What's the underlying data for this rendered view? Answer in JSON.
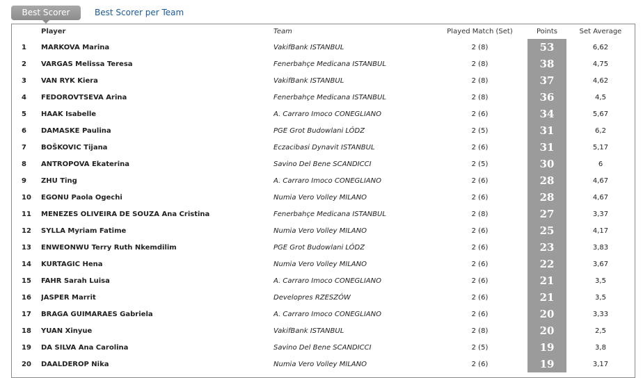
{
  "tabs": {
    "active": "Best Scorer",
    "other": "Best Scorer per Team"
  },
  "columns": {
    "rank": "",
    "player": "Player",
    "team": "Team",
    "played": "Played Match (Set)",
    "points": "Points",
    "avg": "Set Average"
  },
  "rows": [
    {
      "rank": "1",
      "player": "MARKOVA Marina",
      "team": "VakifBank ISTANBUL",
      "played": "2 (8)",
      "points": "53",
      "avg": "6,62"
    },
    {
      "rank": "2",
      "player": "VARGAS Melissa Teresa",
      "team": "Fenerbahçe Medicana ISTANBUL",
      "played": "2 (8)",
      "points": "38",
      "avg": "4,75"
    },
    {
      "rank": "3",
      "player": "VAN RYK Kiera",
      "team": "VakifBank ISTANBUL",
      "played": "2 (8)",
      "points": "37",
      "avg": "4,62"
    },
    {
      "rank": "4",
      "player": "FEDOROVTSEVA Arina",
      "team": "Fenerbahçe Medicana ISTANBUL",
      "played": "2 (8)",
      "points": "36",
      "avg": "4,5"
    },
    {
      "rank": "5",
      "player": "HAAK Isabelle",
      "team": "A. Carraro Imoco CONEGLIANO",
      "played": "2 (6)",
      "points": "34",
      "avg": "5,67"
    },
    {
      "rank": "6",
      "player": "DAMASKE Paulina",
      "team": "PGE Grot Budowlani LÓDZ",
      "played": "2 (5)",
      "points": "31",
      "avg": "6,2"
    },
    {
      "rank": "7",
      "player": "BOŠKOVIC Tijana",
      "team": "Eczacibasi Dynavit ISTANBUL",
      "played": "2 (6)",
      "points": "31",
      "avg": "5,17"
    },
    {
      "rank": "8",
      "player": "ANTROPOVA Ekaterina",
      "team": "Savino Del Bene SCANDICCI",
      "played": "2 (5)",
      "points": "30",
      "avg": "6"
    },
    {
      "rank": "9",
      "player": "ZHU Ting",
      "team": "A. Carraro Imoco CONEGLIANO",
      "played": "2 (6)",
      "points": "28",
      "avg": "4,67"
    },
    {
      "rank": "10",
      "player": "EGONU Paola Ogechi",
      "team": "Numia Vero Volley MILANO",
      "played": "2 (6)",
      "points": "28",
      "avg": "4,67"
    },
    {
      "rank": "11",
      "player": "MENEZES OLIVEIRA DE SOUZA Ana Cristina",
      "team": "Fenerbahçe Medicana ISTANBUL",
      "played": "2 (8)",
      "points": "27",
      "avg": "3,37"
    },
    {
      "rank": "12",
      "player": "SYLLA Myriam Fatime",
      "team": "Numia Vero Volley MILANO",
      "played": "2 (6)",
      "points": "25",
      "avg": "4,17"
    },
    {
      "rank": "13",
      "player": "ENWEONWU Terry Ruth Nkemdilim",
      "team": "PGE Grot Budowlani LÓDZ",
      "played": "2 (6)",
      "points": "23",
      "avg": "3,83"
    },
    {
      "rank": "14",
      "player": "KURTAGIC Hena",
      "team": "Numia Vero Volley MILANO",
      "played": "2 (6)",
      "points": "22",
      "avg": "3,67"
    },
    {
      "rank": "15",
      "player": "FAHR Sarah Luisa",
      "team": "A. Carraro Imoco CONEGLIANO",
      "played": "2 (6)",
      "points": "21",
      "avg": "3,5"
    },
    {
      "rank": "16",
      "player": "JASPER Marrit",
      "team": "Developres RZESZÓW",
      "played": "2 (6)",
      "points": "21",
      "avg": "3,5"
    },
    {
      "rank": "17",
      "player": "BRAGA GUIMARAES Gabriela",
      "team": "A. Carraro Imoco CONEGLIANO",
      "played": "2 (6)",
      "points": "20",
      "avg": "3,33"
    },
    {
      "rank": "18",
      "player": "YUAN Xinyue",
      "team": "VakifBank ISTANBUL",
      "played": "2 (8)",
      "points": "20",
      "avg": "2,5"
    },
    {
      "rank": "19",
      "player": "DA SILVA Ana Carolina",
      "team": "Savino Del Bene SCANDICCI",
      "played": "2 (5)",
      "points": "19",
      "avg": "3,8"
    },
    {
      "rank": "20",
      "player": "DAALDEROP Nika",
      "team": "Numia Vero Volley MILANO",
      "played": "2 (6)",
      "points": "19",
      "avg": "3,17"
    }
  ]
}
